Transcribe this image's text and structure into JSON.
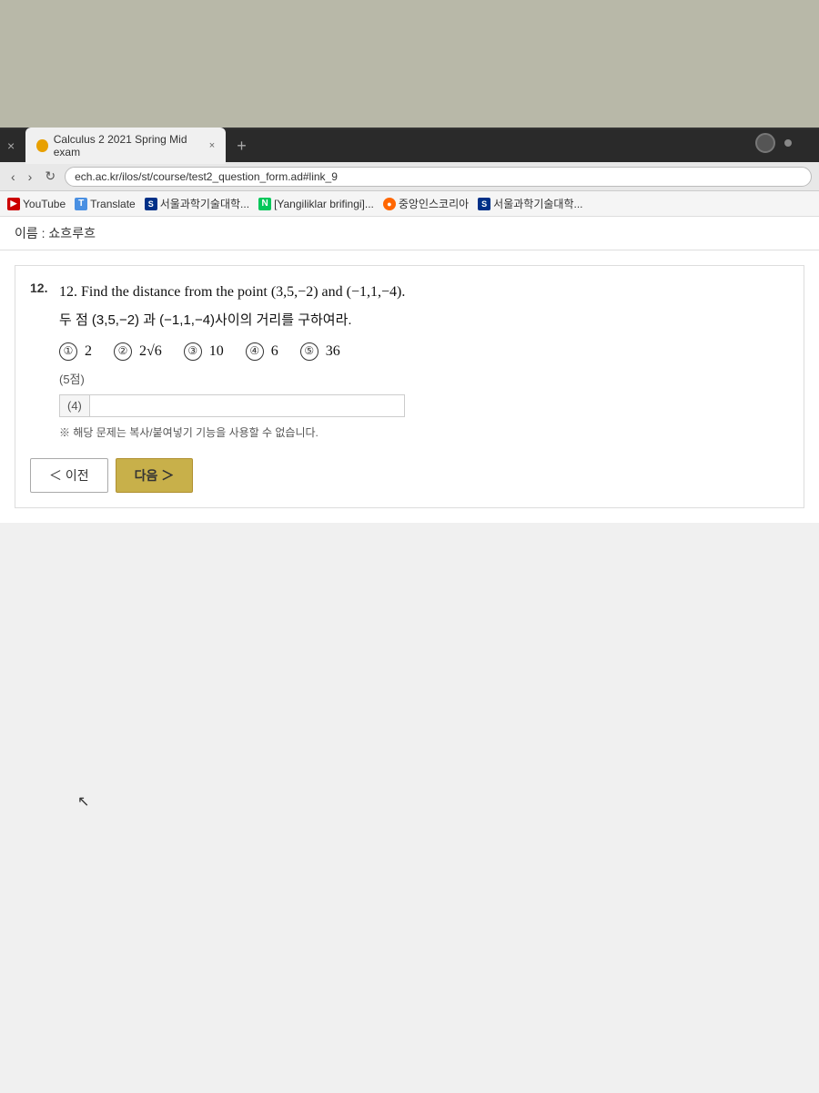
{
  "browser": {
    "tab_title": "Calculus 2 2021 Spring Mid exam",
    "tab_close": "×",
    "tab_new": "+",
    "address": "ech.ac.kr/ilos/st/course/test2_question_form.ad#link_9",
    "bookmarks": [
      {
        "label": "YouTube",
        "icon": "▶",
        "icon_type": "youtube"
      },
      {
        "label": "Translate",
        "icon": "T",
        "icon_type": "translate"
      },
      {
        "label": "서울과학기술대학...",
        "icon": "S",
        "icon_type": "seoultech"
      },
      {
        "label": "[Yangiliklar brifingi]...",
        "icon": "N",
        "icon_type": "naver-n"
      },
      {
        "label": "중앙인스코리아",
        "icon": "●",
        "icon_type": "globe"
      },
      {
        "label": "서울과학기술대학...",
        "icon": "S",
        "icon_type": "seoultech"
      }
    ]
  },
  "page": {
    "name_label": "이름 : 쇼흐루흐"
  },
  "question": {
    "number": "12.",
    "full_number": "12.",
    "text_en": "Find the distance from the point (3,5,−2) and (−1,1,−4).",
    "text_ko": "두 점 (3,5,−2) 과 (−1,1,−4)사이의 거리를 구하여라.",
    "choices": [
      {
        "num": "①",
        "value": "2"
      },
      {
        "num": "②",
        "value": "2√6"
      },
      {
        "num": "③",
        "value": "10"
      },
      {
        "num": "④",
        "value": "6"
      },
      {
        "num": "⑤",
        "value": "36"
      }
    ],
    "points": "(5점)",
    "answer_label": "(4)",
    "answer_placeholder": "",
    "copy_warning": "※ 해당 문제는 복사/붙여넣기 기능을 사용할 수 없습니다.",
    "btn_prev": "＜ 이전",
    "btn_next": "다음 ＞"
  }
}
